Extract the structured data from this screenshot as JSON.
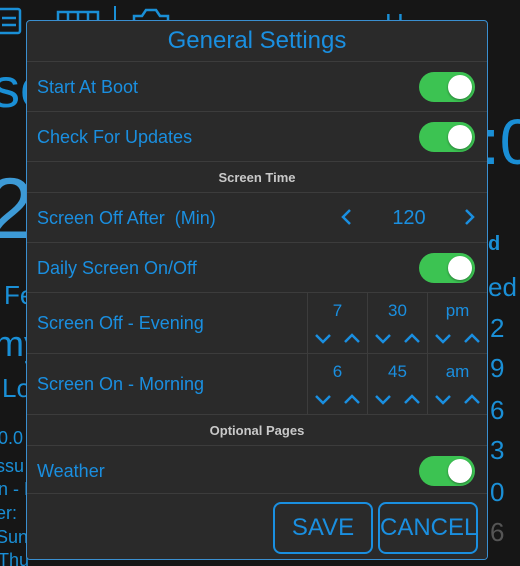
{
  "dialog": {
    "title": "General Settings",
    "rows": {
      "start_at_boot": {
        "label": "Start At Boot",
        "on": true
      },
      "check_updates": {
        "label": "Check For Updates",
        "on": true
      },
      "screen_off_after": {
        "label": "Screen Off After  (Min)",
        "value": "120"
      },
      "daily_screen": {
        "label": "Daily Screen On/Off",
        "on": true
      },
      "screen_off_evening": {
        "label": "Screen Off - Evening",
        "hour": "7",
        "minute": "30",
        "ampm": "pm"
      },
      "screen_on_morning": {
        "label": "Screen On - Morning",
        "hour": "6",
        "minute": "45",
        "ampm": "am"
      },
      "weather": {
        "label": "Weather",
        "on": true
      }
    },
    "sections": {
      "screen_time": "Screen Time",
      "optional_pages": "Optional Pages"
    },
    "buttons": {
      "save": "SAVE",
      "cancel": "CANCEL"
    }
  },
  "background": {
    "fragments": [
      "sc",
      "2",
      "Fe",
      "my",
      "Lo",
      "0.0",
      "ssu",
      "n - E",
      "er:",
      "Sun",
      "Thu",
      ":0",
      "d",
      "ed",
      "2",
      "9",
      "6",
      "3",
      "0",
      "6",
      "H"
    ]
  },
  "colors": {
    "accent": "#1a8fe0",
    "toggle_on": "#3cc352",
    "dialog_bg": "#2a2a2a"
  }
}
